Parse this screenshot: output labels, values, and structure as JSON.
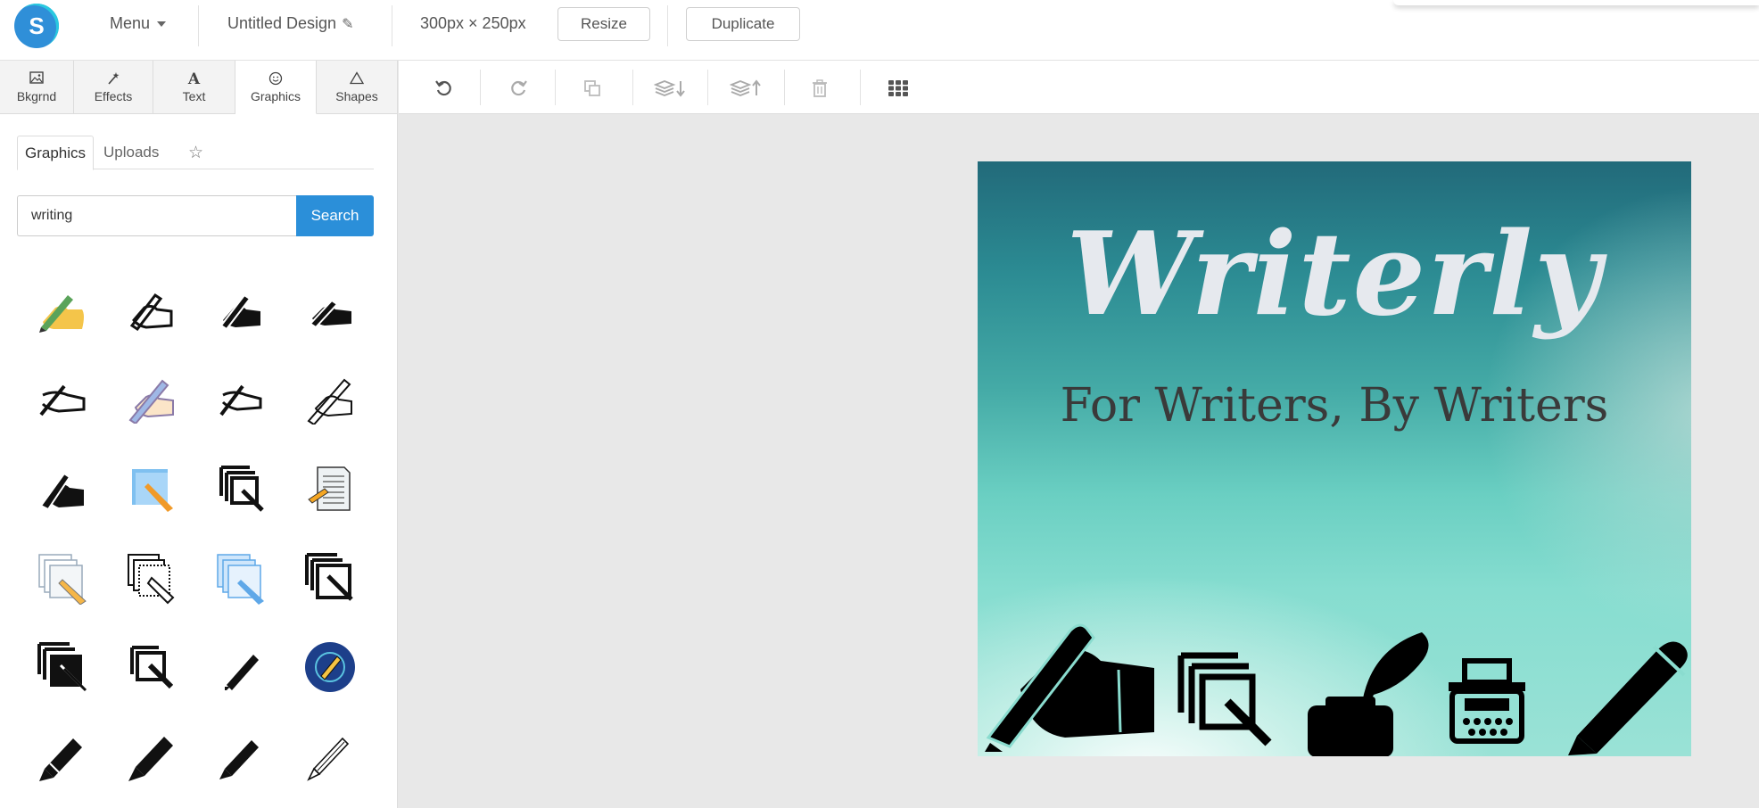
{
  "header": {
    "logo_letter": "S",
    "menu_label": "Menu",
    "design_title": "Untitled Design",
    "size_label": "300px × 250px",
    "resize_label": "Resize",
    "duplicate_label": "Duplicate"
  },
  "tabs": [
    {
      "label": "Bkgrnd",
      "icon": "image-icon"
    },
    {
      "label": "Effects",
      "icon": "magic-wand-icon"
    },
    {
      "label": "Text",
      "icon": "text-a-icon"
    },
    {
      "label": "Graphics",
      "icon": "smiley-icon",
      "active": true
    },
    {
      "label": "Shapes",
      "icon": "triangle-icon"
    }
  ],
  "toolbar": {
    "tools": [
      "undo-icon",
      "redo-icon",
      "copy-icon",
      "layer-down-icon",
      "layer-up-icon",
      "trash-icon",
      "grid-icon"
    ]
  },
  "panel": {
    "subtabs": {
      "graphics": "Graphics",
      "uploads": "Uploads",
      "favorites": "star-icon"
    },
    "search": {
      "value": "writing",
      "button_label": "Search"
    },
    "results": [
      "writing-hand-color-icon",
      "writing-hand-outline-icon",
      "writing-hand-filled-icon",
      "writing-hand-solid-icon",
      "signing-hand-icon",
      "writing-hand-pen-color-icon",
      "signing-hand-small-icon",
      "hand-pen-outline-icon",
      "hand-pen-filled-icon",
      "blue-note-pencil-icon",
      "copy-edit-icon",
      "document-pencil-icon",
      "pages-pencil-outline-icon",
      "pages-pointer-icon",
      "blue-pages-pencil-icon",
      "pages-edit-black-icon",
      "pages-edit-solid-icon",
      "copy-edit-small-icon",
      "pencil-small-icon",
      "blue-circle-pen-icon",
      "pencil-filled-icon",
      "pencil-bold-icon",
      "pencil-thin-icon",
      "pencil-outline-icon"
    ]
  },
  "canvas": {
    "title": "Writerly",
    "subtitle": "For Writers, By Writers",
    "icons": [
      "writing-hand-icon",
      "copy-edit-icon",
      "inkwell-quill-icon",
      "typewriter-icon",
      "pen-icon"
    ],
    "colors": {
      "title": "#e6e9ee",
      "subtitle": "#3a3a3a",
      "gradient_top": "#226a7a",
      "gradient_bottom": "#9ae2d6"
    }
  },
  "colors": {
    "accent": "#2b8fd9",
    "logo": "#2f8fd8"
  }
}
